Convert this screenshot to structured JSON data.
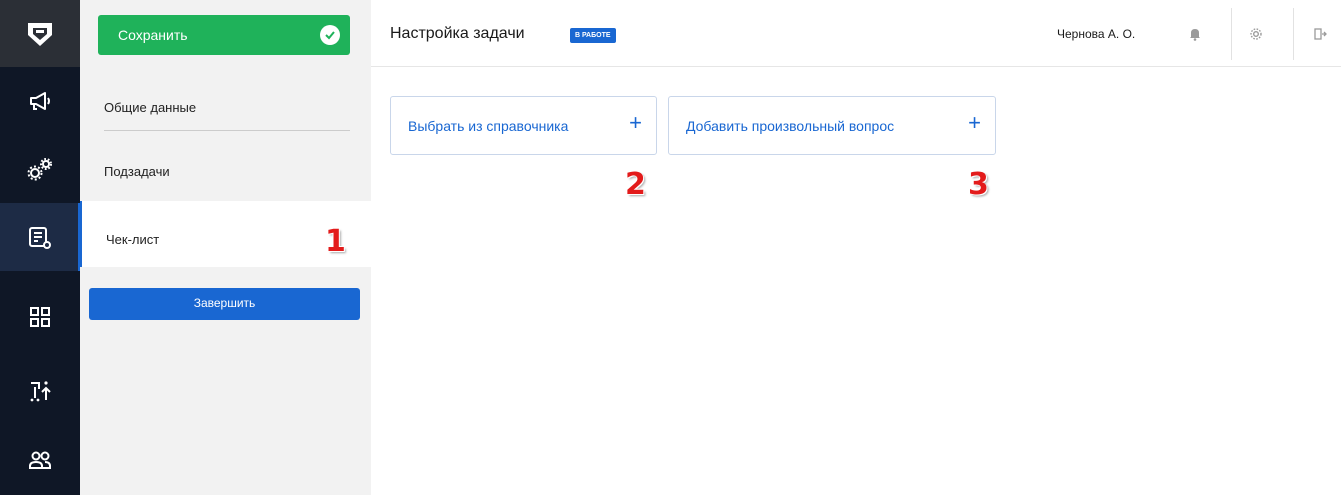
{
  "toolbar": {
    "save_label": "Сохранить"
  },
  "nav": {
    "items": [
      {
        "label": "Общие данные"
      },
      {
        "label": "Подзадачи"
      },
      {
        "label": "Чек-лист"
      }
    ],
    "finish_label": "Завершить"
  },
  "header": {
    "title": "Настройка задачи",
    "status": "В РАБОТЕ",
    "user": "Чернова А. О."
  },
  "actions": {
    "choose_label": "Выбрать из справочника",
    "add_label": "Добавить произвольный вопрос",
    "plus": "+"
  },
  "annotations": [
    "1",
    "2",
    "3"
  ],
  "colors": {
    "accent": "#1967d2",
    "save_green": "#1fb25a",
    "rail_bg": "#0f1726",
    "annotation_red": "#e31b1b"
  },
  "icons": [
    "logo-shield-icon",
    "megaphone-icon",
    "gears-icon",
    "checklist-icon",
    "grid-icon",
    "sort-icon",
    "users-icon",
    "bell-icon",
    "gear-icon",
    "logout-icon",
    "check-icon",
    "plus-icon"
  ]
}
